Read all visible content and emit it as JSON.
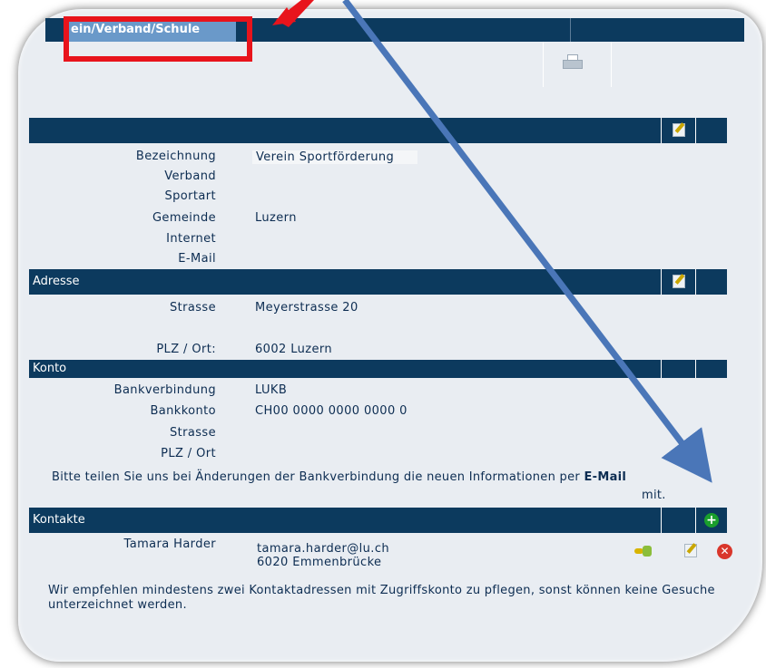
{
  "tab": {
    "label": "ein/Verband/Schule"
  },
  "sections": {
    "main": {
      "rows": [
        {
          "label": "Bezeichnung",
          "value": "Verein Sportförderung"
        },
        {
          "label": "Verband",
          "value": ""
        },
        {
          "label": "Sportart",
          "value": ""
        },
        {
          "label": "Gemeinde",
          "value": "Luzern"
        },
        {
          "label": "Internet",
          "value": ""
        },
        {
          "label": "E-Mail",
          "value": ""
        }
      ]
    },
    "adresse": {
      "title": "Adresse",
      "rows": [
        {
          "label": "Strasse",
          "value": "Meyerstrasse 20"
        },
        {
          "label": "PLZ / Ort:",
          "value": "6002 Luzern"
        }
      ]
    },
    "konto": {
      "title": "Konto",
      "rows": [
        {
          "label": "Bankverbindung",
          "value": "LUKB"
        },
        {
          "label": "Bankkonto",
          "value": "CH00 0000 0000 0000 0"
        },
        {
          "label": "Strasse",
          "value": ""
        },
        {
          "label": "PLZ / Ort",
          "value": ""
        }
      ],
      "notice_before": "Bitte teilen Sie uns bei Änderungen der Bankverbindung die neuen Informationen per ",
      "notice_link": "E-Mail",
      "notice_after": "mit."
    },
    "kontakte": {
      "title": "Kontakte",
      "contact": {
        "name": "Tamara Harder",
        "email": "tamara.harder@lu.ch",
        "city": "6020 Emmenbrücke"
      },
      "notice": "Wir empfehlen mindestens zwei Kontaktadressen mit Zugriffskonto zu pflegen, sonst können keine Gesuche unterzeichnet werden."
    }
  },
  "icons": {
    "print": "print-icon",
    "edit": "edit-icon",
    "add": "add-icon",
    "keys": "keys-icon",
    "delete": "delete-icon"
  },
  "colors": {
    "header": "#0c3a5e",
    "tab": "#6a99c9",
    "panel": "#e9edf2",
    "annotation_box": "#e8141c",
    "arrow": "#4a76b8"
  }
}
